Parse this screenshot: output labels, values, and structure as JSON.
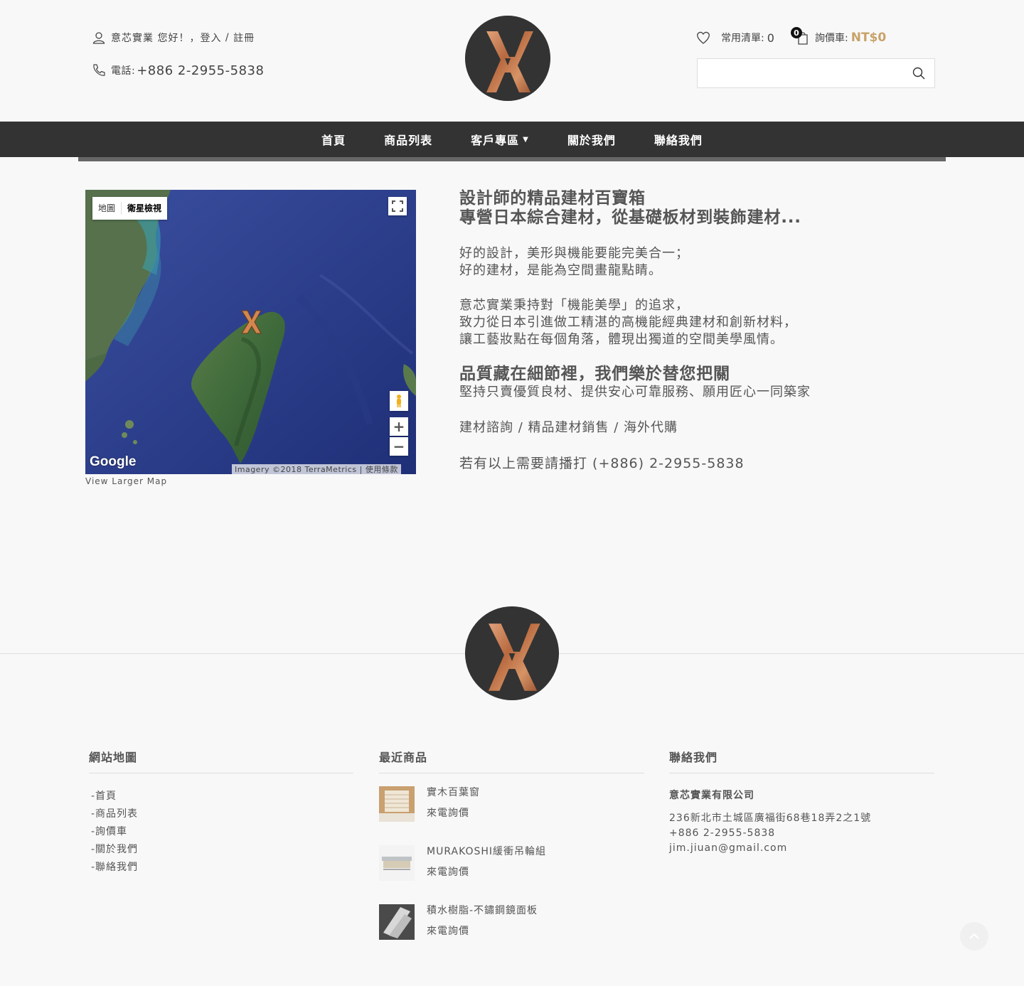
{
  "header": {
    "greeting": "意芯實業 您好！，",
    "login_label": "登入",
    "separator": " / ",
    "register_label": "註冊",
    "phone_label": "電話:",
    "phone_number": "+886 2-2955-5838",
    "wishlist_label": "常用清單:",
    "wishlist_count": "0",
    "cart_badge": "0",
    "cart_label": "詢價車:",
    "cart_total": "NT$0",
    "search_placeholder": ""
  },
  "nav": {
    "items": [
      {
        "label": "首頁"
      },
      {
        "label": "商品列表"
      },
      {
        "label": "客戶專區"
      },
      {
        "label": "關於我們"
      },
      {
        "label": "聯絡我們"
      }
    ]
  },
  "map": {
    "type_map": "地圖",
    "type_satellite": "衛星檢視",
    "zoom_in": "+",
    "zoom_out": "−",
    "google": "Google",
    "imagery": "Imagery ©2018 TerraMetrics",
    "terms": "使用條款",
    "view_larger": "View Larger Map"
  },
  "intro": {
    "heading_1": "設計師的精品建材百寶箱",
    "heading_2": "專營日本綜合建材，從基礎板材到裝飾建材...",
    "p1_line1": "好的設計，美形與機能要能完美合一；",
    "p1_line2": "好的建材，是能為空間畫龍點睛。",
    "p2_line1": "意芯實業秉持對「機能美學」的追求，",
    "p2_line2": "致力從日本引進做工精湛的高機能經典建材和創新材料，",
    "p2_line3": "讓工藝妝點在每個角落，體現出獨道的空間美學風情。",
    "heading_3": "品質藏在細節裡，我們樂於替您把關",
    "p3_line1": "堅持只賣優質良材、提供安心可靠服務、願用匠心一同築家",
    "services": "建材諮詢 / 精品建材銷售 / 海外代購",
    "call": "若有以上需要請播打 (+886) 2-2955-5838"
  },
  "footer": {
    "sitemap_title": "網站地圖",
    "sitemap": [
      "-首頁",
      "-商品列表",
      "-詢價車",
      "-關於我們",
      "-聯絡我們"
    ],
    "recent_title": "最近商品",
    "products": [
      {
        "name": "實木百葉窗",
        "price": "來電詢價"
      },
      {
        "name": "MURAKOSHI緩衝吊輪組",
        "price": "來電詢價"
      },
      {
        "name": "積水樹脂-不鏽鋼鏡面板",
        "price": "來電詢價"
      }
    ],
    "contact_title": "聯絡我們",
    "company": "意芯實業有限公司",
    "address": "236新北市土城區廣福街68巷18弄2之1號",
    "phone": "+886 2-2955-5838",
    "email": "jim.jiuan@gmail.com"
  },
  "colors": {
    "nav_bg": "#333333",
    "accent_gold": "#c8a26a",
    "page_bg": "#f8f8f8"
  }
}
